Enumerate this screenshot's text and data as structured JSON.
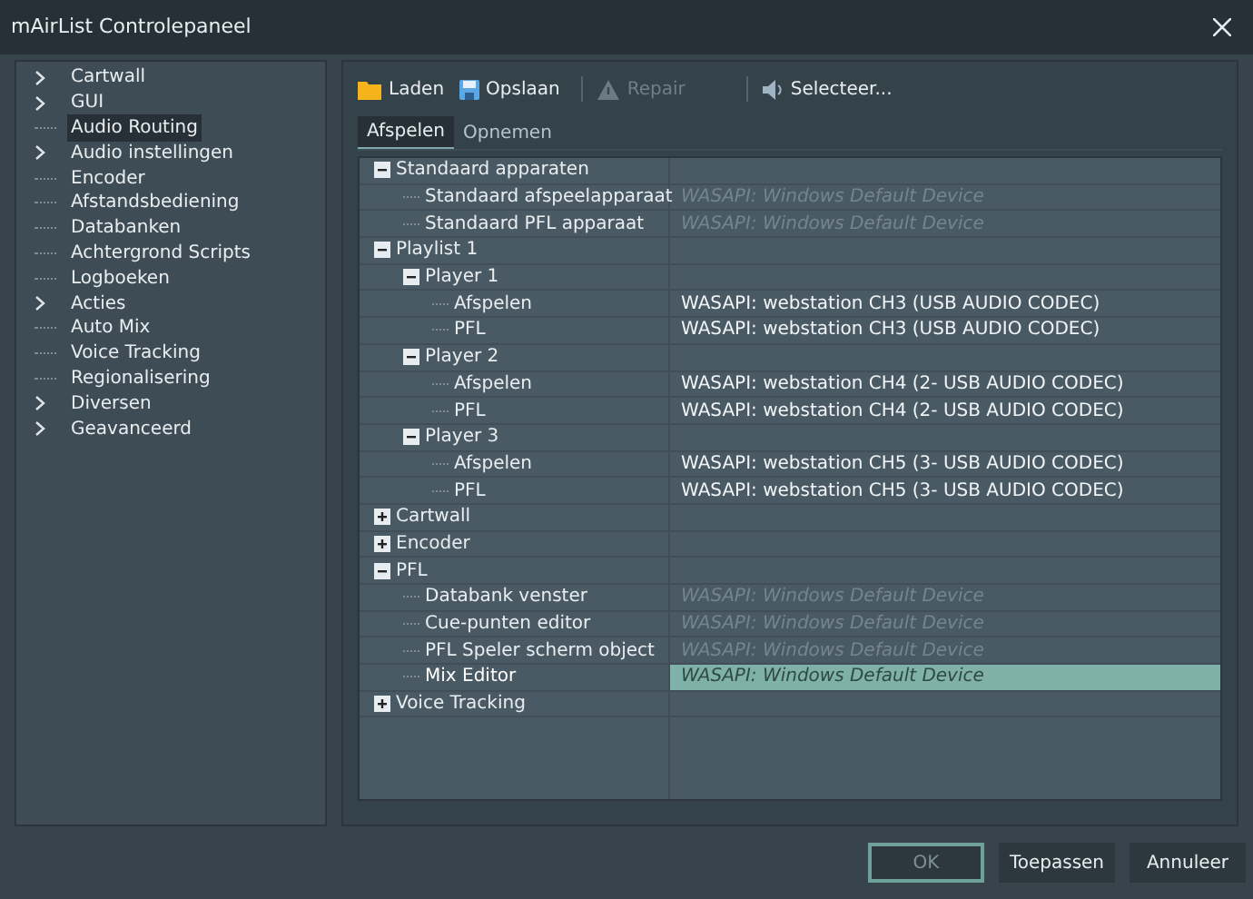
{
  "window": {
    "title": "mAirList Controlepaneel"
  },
  "sidebar": {
    "items": [
      {
        "label": "Cartwall",
        "expandable": true,
        "selected": false
      },
      {
        "label": "GUI",
        "expandable": true,
        "selected": false
      },
      {
        "label": "Audio Routing",
        "expandable": false,
        "selected": true
      },
      {
        "label": "Audio instellingen",
        "expandable": true,
        "selected": false
      },
      {
        "label": "Encoder",
        "expandable": false,
        "selected": false
      },
      {
        "label": "Afstandsbediening",
        "expandable": false,
        "selected": false
      },
      {
        "label": "Databanken",
        "expandable": false,
        "selected": false
      },
      {
        "label": "Achtergrond Scripts",
        "expandable": false,
        "selected": false
      },
      {
        "label": "Logboeken",
        "expandable": false,
        "selected": false
      },
      {
        "label": "Acties",
        "expandable": true,
        "selected": false
      },
      {
        "label": "Auto Mix",
        "expandable": false,
        "selected": false
      },
      {
        "label": "Voice Tracking",
        "expandable": false,
        "selected": false
      },
      {
        "label": "Regionalisering",
        "expandable": false,
        "selected": false
      },
      {
        "label": "Diversen",
        "expandable": true,
        "selected": false
      },
      {
        "label": "Geavanceerd",
        "expandable": true,
        "selected": false
      }
    ]
  },
  "toolbar": [
    {
      "kind": "open",
      "label": "Laden",
      "disabled": false
    },
    {
      "kind": "save",
      "label": "Opslaan",
      "disabled": false
    },
    {
      "kind": "repair",
      "label": "Repair",
      "disabled": true
    },
    {
      "kind": "select",
      "label": "Selecteer...",
      "disabled": false
    }
  ],
  "tabs": [
    {
      "label": "Afspelen",
      "selected": true
    },
    {
      "label": "Opnemen",
      "selected": false
    }
  ],
  "tree": [
    {
      "kind": "group",
      "label": "Standaard apparaten",
      "expanded": true,
      "selected": false,
      "children": [
        {
          "kind": "device",
          "label": "Standaard afspeelapparaat",
          "value": "WASAPI: Windows Default Device",
          "is_default": true,
          "selected": false
        },
        {
          "kind": "device",
          "label": "Standaard PFL apparaat",
          "value": "WASAPI: Windows Default Device",
          "is_default": true,
          "selected": false
        }
      ]
    },
    {
      "kind": "group",
      "label": "Playlist 1",
      "expanded": true,
      "selected": false,
      "children": [
        {
          "kind": "group",
          "label": "Player 1",
          "expanded": true,
          "selected": false,
          "children": [
            {
              "kind": "device",
              "label": "Afspelen",
              "value": "WASAPI: webstation CH3 (USB AUDIO  CODEC)",
              "is_default": false,
              "selected": false
            },
            {
              "kind": "device",
              "label": "PFL",
              "value": "WASAPI: webstation CH3 (USB AUDIO  CODEC)",
              "is_default": false,
              "selected": false
            }
          ]
        },
        {
          "kind": "group",
          "label": "Player 2",
          "expanded": true,
          "selected": false,
          "children": [
            {
              "kind": "device",
              "label": "Afspelen",
              "value": "WASAPI: webstation CH4 (2- USB AUDIO  CODEC)",
              "is_default": false,
              "selected": false
            },
            {
              "kind": "device",
              "label": "PFL",
              "value": "WASAPI: webstation CH4 (2- USB AUDIO  CODEC)",
              "is_default": false,
              "selected": false
            }
          ]
        },
        {
          "kind": "group",
          "label": "Player 3",
          "expanded": true,
          "selected": false,
          "children": [
            {
              "kind": "device",
              "label": "Afspelen",
              "value": "WASAPI: webstation CH5 (3- USB AUDIO  CODEC)",
              "is_default": false,
              "selected": false
            },
            {
              "kind": "device",
              "label": "PFL",
              "value": "WASAPI: webstation CH5 (3- USB AUDIO  CODEC)",
              "is_default": false,
              "selected": false
            }
          ]
        }
      ]
    },
    {
      "kind": "group",
      "label": "Cartwall",
      "expanded": false,
      "selected": false
    },
    {
      "kind": "group",
      "label": "Encoder",
      "expanded": false,
      "selected": false
    },
    {
      "kind": "group",
      "label": "PFL",
      "expanded": true,
      "selected": false,
      "children": [
        {
          "kind": "device",
          "label": "Databank venster",
          "value": "WASAPI: Windows Default Device",
          "is_default": true,
          "selected": false
        },
        {
          "kind": "device",
          "label": "Cue-punten editor",
          "value": "WASAPI: Windows Default Device",
          "is_default": true,
          "selected": false
        },
        {
          "kind": "device",
          "label": "PFL Speler scherm object",
          "value": "WASAPI: Windows Default Device",
          "is_default": true,
          "selected": false
        },
        {
          "kind": "device",
          "label": "Mix Editor",
          "value": "WASAPI: Windows Default Device",
          "is_default": true,
          "selected": true
        }
      ]
    },
    {
      "kind": "group",
      "label": "Voice Tracking",
      "expanded": false,
      "selected": false
    }
  ],
  "buttons": [
    {
      "label": "OK",
      "default": true
    },
    {
      "label": "Toepassen",
      "default": false
    },
    {
      "label": "Annuleer",
      "default": false
    }
  ]
}
